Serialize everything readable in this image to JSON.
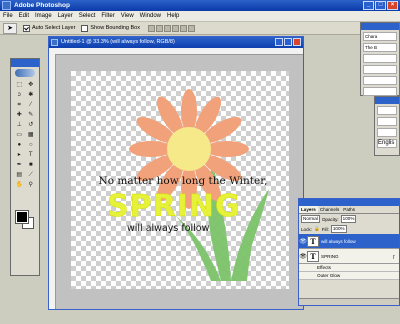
{
  "window": {
    "title": "Adobe Photoshop",
    "min": "_",
    "max": "□",
    "close": "×"
  },
  "menu": [
    "File",
    "Edit",
    "Image",
    "Layer",
    "Select",
    "Filter",
    "View",
    "Window",
    "Help"
  ],
  "options": {
    "auto_select": "Auto Select Layer",
    "bounding_box": "Show Bounding Box"
  },
  "document": {
    "title": "Untitled-1 @ 33.3% (will always follow, RGB/8)"
  },
  "artwork": {
    "line1": "No matter how long the Winter,",
    "line2": "SPRING",
    "line3": "will always follow"
  },
  "right_panels": {
    "tab1": "Chara",
    "font": "The B",
    "font2": "Englis"
  },
  "layers": {
    "tabs": [
      "Layers",
      "Channels",
      "Paths"
    ],
    "blend": "Normal",
    "opacity_label": "Opacity:",
    "opacity": "100%",
    "lock_label": "Lock:",
    "fill_label": "Fill:",
    "fill": "100%",
    "items": [
      {
        "name": "will always follow",
        "eye": "👁",
        "selected": true
      },
      {
        "name": "SPRING",
        "eye": "👁",
        "selected": false
      }
    ],
    "effects": "Effects",
    "outer_glow": "Outer Glow"
  }
}
